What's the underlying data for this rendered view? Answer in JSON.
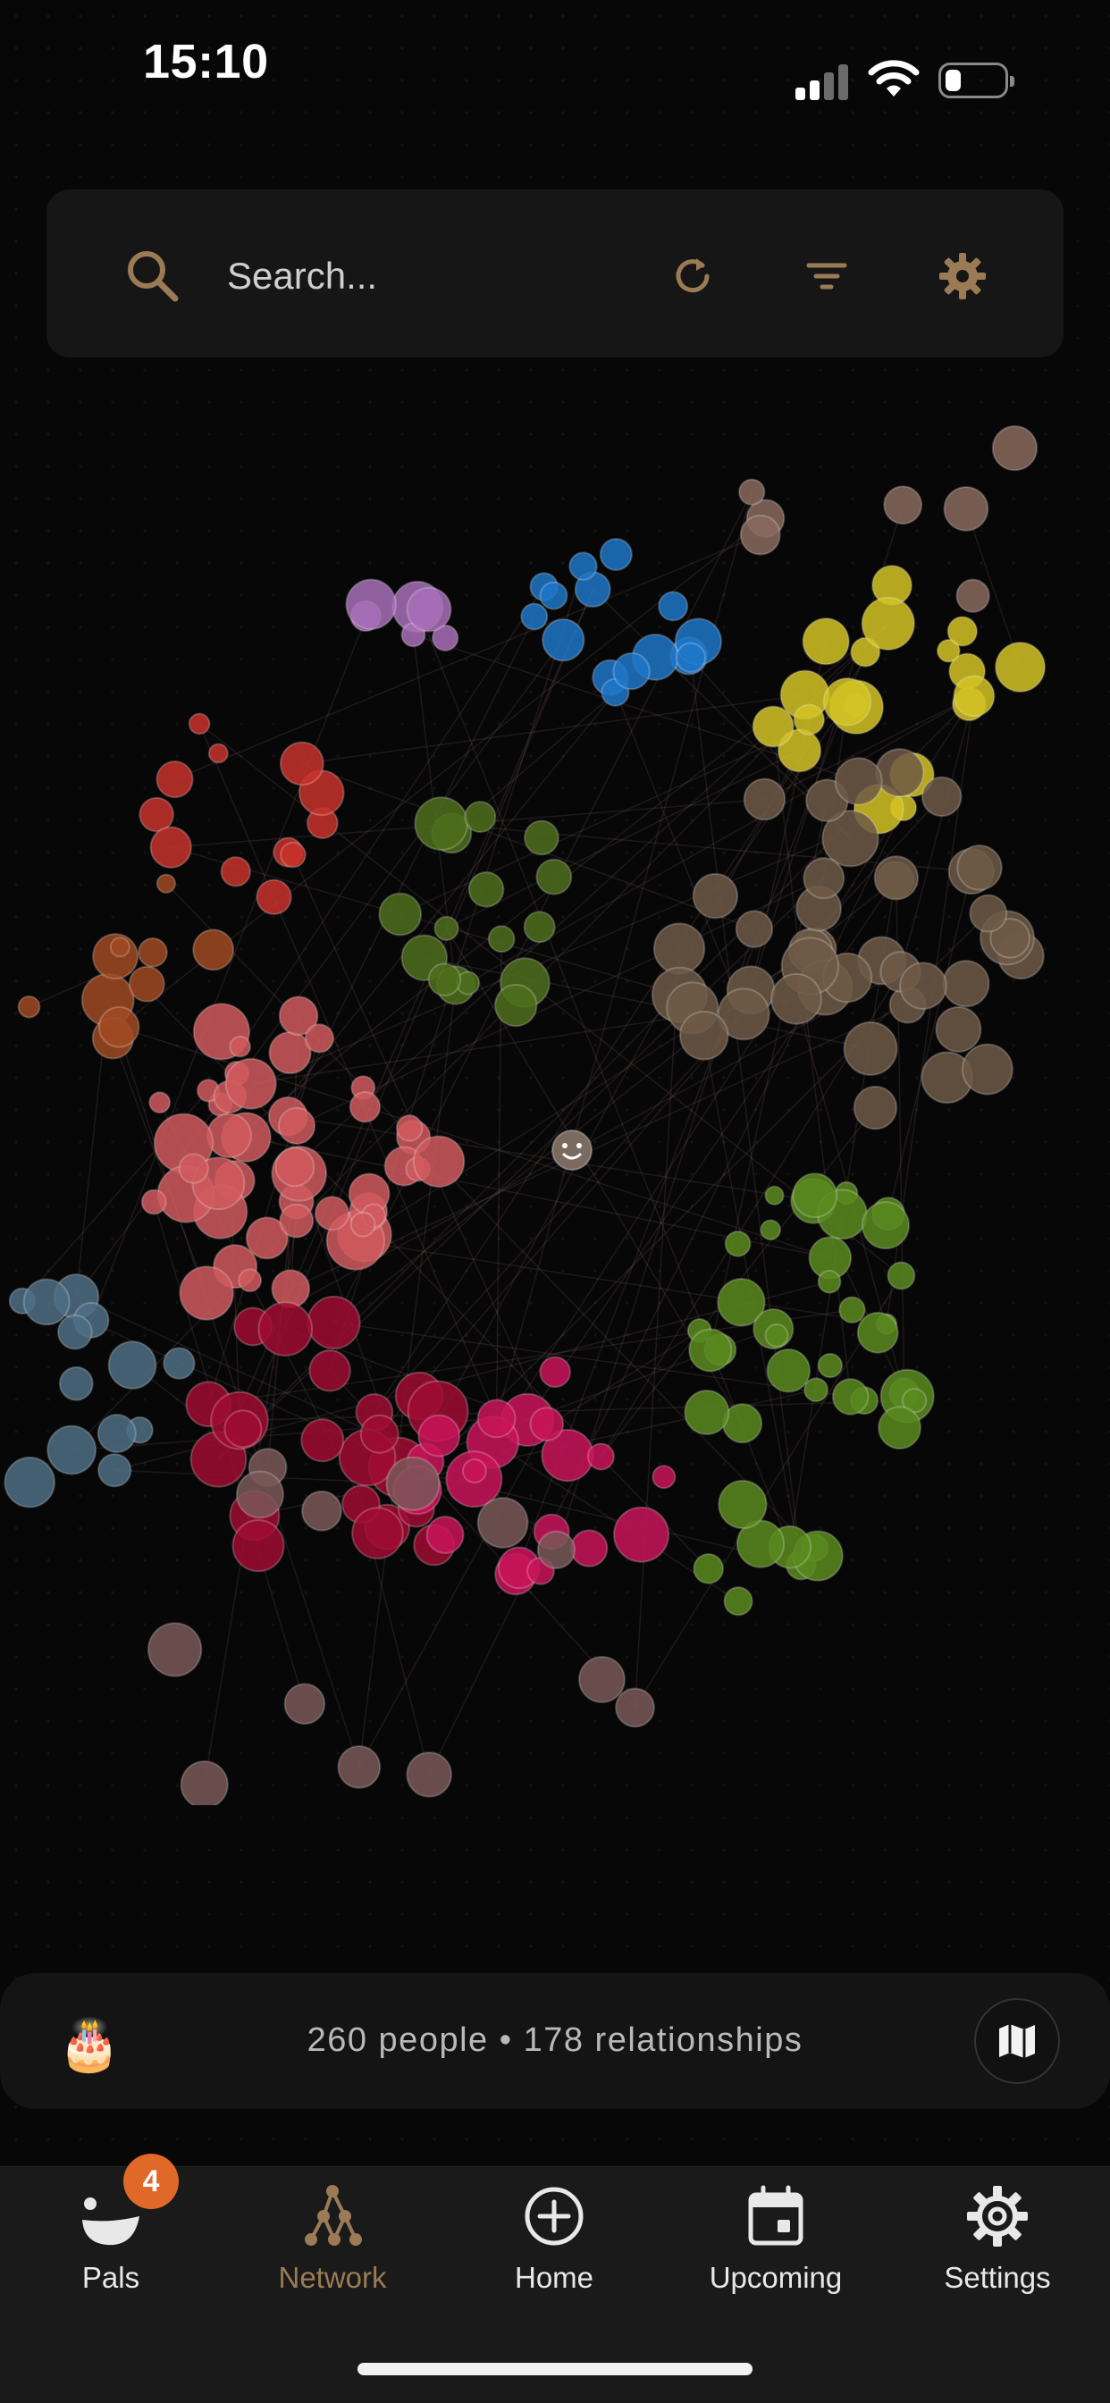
{
  "status": {
    "time": "15:10"
  },
  "search": {
    "placeholder": "Search..."
  },
  "stats": {
    "text": "260 people • 178 relationships"
  },
  "tabs": [
    {
      "label": "Pals",
      "badge": "4",
      "icon": "pals-icon"
    },
    {
      "label": "Network",
      "icon": "network-icon",
      "active": true
    },
    {
      "label": "Home",
      "icon": "plus-circle-icon"
    },
    {
      "label": "Upcoming",
      "icon": "calendar-icon"
    },
    {
      "label": "Settings",
      "icon": "gear-icon"
    }
  ],
  "colors": {
    "accent": "#9a7b55",
    "badge": "#e0692a",
    "cluster_blue": "#1f77c8",
    "cluster_yellow": "#d4c324",
    "cluster_tan": "#6e5a46",
    "cluster_olive": "#4d6e1c",
    "cluster_salmon": "#d05a5e",
    "cluster_crimson": "#a00c33",
    "cluster_pink": "#c9145a",
    "cluster_red": "#c8322b",
    "cluster_orange": "#a04a22",
    "cluster_steel": "#4f6e84",
    "cluster_lime": "#5a8a1e"
  }
}
